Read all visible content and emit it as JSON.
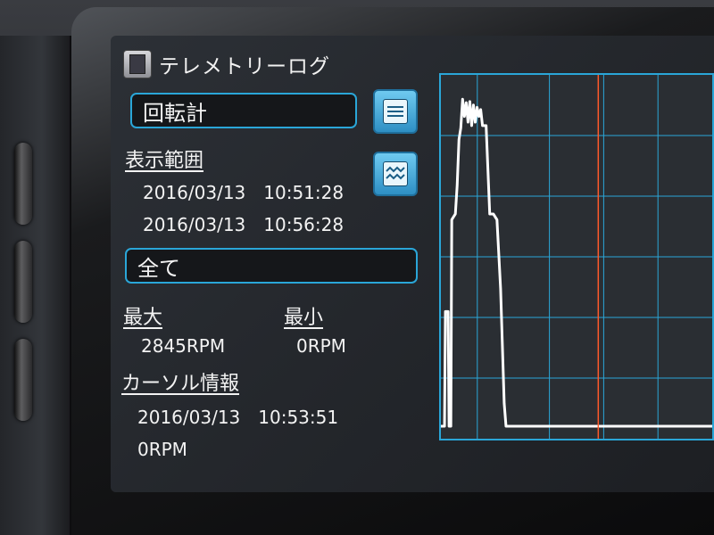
{
  "app": {
    "title": "テレメトリーログ",
    "icon": "document-icon"
  },
  "sensor": {
    "selected": "回転計"
  },
  "display_range": {
    "heading": "表示範囲",
    "start": "2016/03/13　10:51:28",
    "end": "2016/03/13　10:56:28"
  },
  "filter": {
    "selected": "全て"
  },
  "stats": {
    "max_label": "最大",
    "max_value": "2845RPM",
    "min_label": "最小",
    "min_value": "0RPM"
  },
  "cursor": {
    "heading": "カーソル情報",
    "time": "2016/03/13　10:53:51",
    "value": "0RPM",
    "fraction": 0.58
  },
  "buttons": {
    "list_icon": "list-icon",
    "graph_icon": "waveform-icon"
  },
  "colors": {
    "accent": "#2aa6d8",
    "grid": "#2aa6d8",
    "trace": "#ffffff",
    "cursor": "#ff5a2a",
    "screen_bg": "#24272c"
  },
  "chart_data": {
    "type": "line",
    "grid": true,
    "x_range": [
      0,
      300
    ],
    "y_range": [
      0,
      3000
    ],
    "series": [
      {
        "points": [
          [
            0,
            0
          ],
          [
            4,
            0
          ],
          [
            5,
            1000
          ],
          [
            8,
            1000
          ],
          [
            9,
            0
          ],
          [
            11,
            0
          ],
          [
            12,
            1800
          ],
          [
            16,
            1850
          ],
          [
            18,
            2100
          ],
          [
            20,
            2500
          ],
          [
            22,
            2600
          ],
          [
            24,
            2850
          ],
          [
            26,
            2700
          ],
          [
            28,
            2820
          ],
          [
            30,
            2650
          ],
          [
            32,
            2830
          ],
          [
            34,
            2620
          ],
          [
            36,
            2800
          ],
          [
            38,
            2650
          ],
          [
            40,
            2780
          ],
          [
            42,
            2700
          ],
          [
            44,
            2760
          ],
          [
            46,
            2620
          ],
          [
            50,
            2620
          ],
          [
            54,
            1850
          ],
          [
            58,
            1850
          ],
          [
            62,
            1800
          ],
          [
            66,
            1200
          ],
          [
            70,
            200
          ],
          [
            72,
            0
          ],
          [
            300,
            0
          ]
        ]
      }
    ]
  }
}
